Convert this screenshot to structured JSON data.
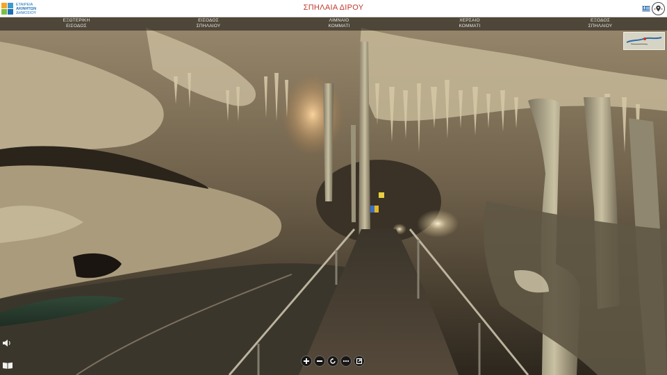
{
  "header": {
    "title": "ΣΠΗΛΑΙΑ ΔΙΡΟΥ",
    "logo": {
      "line1": "ΕΤΑΙΡΕΙΑ",
      "line2": "ΑΚΙΝΗΤΩΝ",
      "line3": "ΔΗΜΟΣΙΟΥ",
      "colors": [
        "#f5a623",
        "#3d9ad1",
        "#7bbf44",
        "#1c6fb5"
      ]
    },
    "language_flag": "greek-flag",
    "map_toggle_icon": "map-pin-icon"
  },
  "nav": {
    "items": [
      {
        "line1": "ΕΞΩΤΕΡΙΚΗ",
        "line2": "ΕΙΣΟΔΟΣ"
      },
      {
        "line1": "ΕΙΣΟΔΟΣ",
        "line2": "ΣΠΗΛΑΙΟΥ"
      },
      {
        "line1": "ΛΙΜΝΑΙΟ",
        "line2": "ΚΟΜΜΑΤΙ"
      },
      {
        "line1": "ΧΕΡΣΑΙΟ",
        "line2": "ΚΟΜΜΑΤΙ"
      },
      {
        "line1": "ΕΞΟΔΟΣ",
        "line2": "ΣΠΗΛΑΙΟΥ"
      }
    ]
  },
  "controls": {
    "buttons": [
      "zoom-in-icon",
      "zoom-out-icon",
      "autorotate-icon",
      "more-icon",
      "fullscreen-icon"
    ]
  },
  "side": {
    "sound_icon": "speaker-icon",
    "info_icon": "book-icon"
  },
  "colors": {
    "title": "#c0392b",
    "header_bg": "#ffffff",
    "nav_text": "#e8e8e8",
    "flag_blue": "#0d5eaf"
  }
}
